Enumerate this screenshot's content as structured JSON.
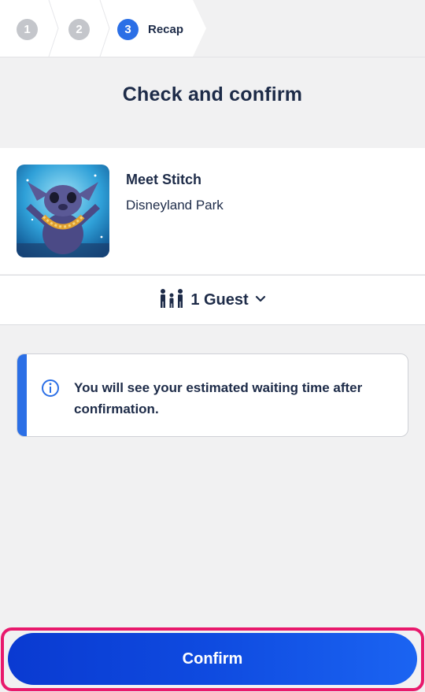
{
  "stepper": {
    "steps": [
      {
        "number": "1",
        "state": "done"
      },
      {
        "number": "2",
        "state": "done"
      },
      {
        "number": "3",
        "state": "active",
        "label": "Recap"
      }
    ]
  },
  "page_title": "Check and confirm",
  "experience": {
    "name": "Meet Stitch",
    "park": "Disneyland Park",
    "image_icon": "stitch-photo"
  },
  "guests": {
    "label": "1 Guest",
    "icon": "family-icon",
    "chevron_icon": "chevron-down-icon"
  },
  "info": {
    "icon": "info-icon",
    "text": "You will see your estimated waiting time after confirmation."
  },
  "confirm_label": "Confirm",
  "colors": {
    "accent": "#2b6fe6",
    "text": "#1d2b48",
    "background": "#f1f1f2",
    "highlight": "#e8196c"
  }
}
